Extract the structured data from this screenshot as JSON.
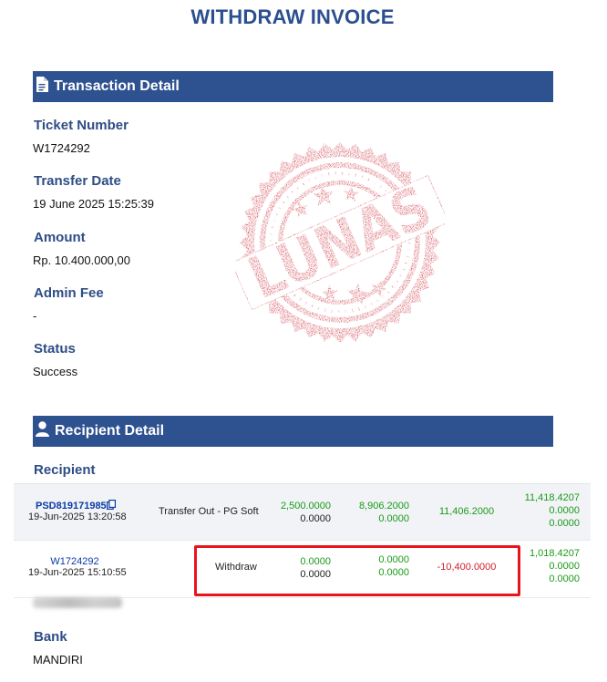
{
  "page_title": "WITHDRAW INVOICE",
  "sections": {
    "transaction": {
      "heading": "Transaction Detail",
      "icon": "document-icon",
      "fields": [
        {
          "label": "Ticket Number",
          "value": "W1724292"
        },
        {
          "label": "Transfer Date",
          "value": "19 June 2025 15:25:39"
        },
        {
          "label": "Amount",
          "value": "Rp. 10.400.000,00"
        },
        {
          "label": "Admin Fee",
          "value": "-"
        },
        {
          "label": "Status",
          "value": "Success"
        }
      ]
    },
    "recipient": {
      "heading": "Recipient Detail",
      "icon": "user-icon",
      "recipient_label": "Recipient",
      "bank_label": "Bank",
      "bank_value": "MANDIRI"
    }
  },
  "transactions": [
    {
      "id": "PSD819171985",
      "datetime": "19-Jun-2025 13:20:58",
      "type": "Transfer Out - PG Soft",
      "col1": [
        "2,500.0000",
        "0.0000"
      ],
      "col2": [
        "8,906.2000",
        "0.0000"
      ],
      "col3": "11,406.2000",
      "balance": [
        "11,418.4207",
        "0.0000",
        "0.0000"
      ]
    },
    {
      "id": "W1724292",
      "datetime": "19-Jun-2025 15:10:55",
      "type": "Withdraw",
      "col1": [
        "0.0000",
        "0.0000"
      ],
      "col2": [
        "0.0000",
        "0.0000"
      ],
      "col3": "-10,400.0000",
      "balance": [
        "1,018.4207",
        "0.0000",
        "0.0000"
      ]
    }
  ],
  "stamp": {
    "text": "LUNAS"
  },
  "colors": {
    "title": "#2b4f8f",
    "section_bar": "#2e5190",
    "label": "#2e4d85",
    "positive": "#1a9b1a",
    "negative": "#d0202c",
    "highlight": "#e8141c",
    "stamp": "#c8202e"
  }
}
